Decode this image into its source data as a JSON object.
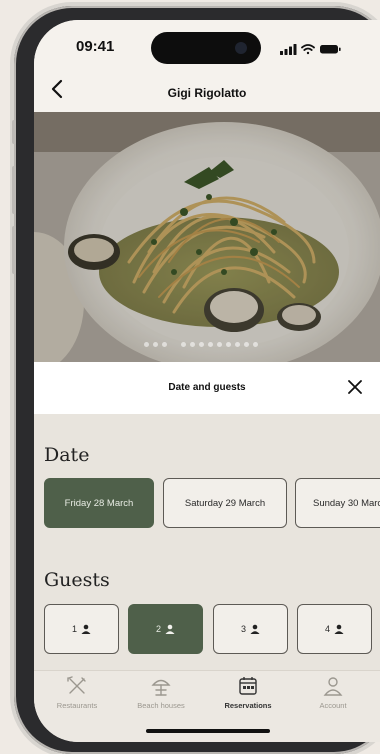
{
  "status": {
    "time": "09:41"
  },
  "header": {
    "title": "Gigi Rigolatto",
    "back_icon": "chevron-left-icon"
  },
  "sheet": {
    "title": "Date and guests",
    "close_icon": "close-icon",
    "date_label": "Date",
    "dates": [
      "Friday 28 March",
      "Saturday 29 March",
      "Sunday 30 March"
    ],
    "selected_date_index": 0,
    "guests_label": "Guests",
    "guests": [
      "1",
      "2",
      "3",
      "4"
    ],
    "selected_guest_index": 1
  },
  "tabs": [
    {
      "label": "Restaurants",
      "icon": "utensils-icon"
    },
    {
      "label": "Beach houses",
      "icon": "beach-umbrella-icon"
    },
    {
      "label": "Reservations",
      "icon": "calendar-icon"
    },
    {
      "label": "Account",
      "icon": "person-icon"
    }
  ],
  "active_tab_index": 2,
  "colors": {
    "accent": "#4f604a",
    "background": "#e8e4dd"
  }
}
